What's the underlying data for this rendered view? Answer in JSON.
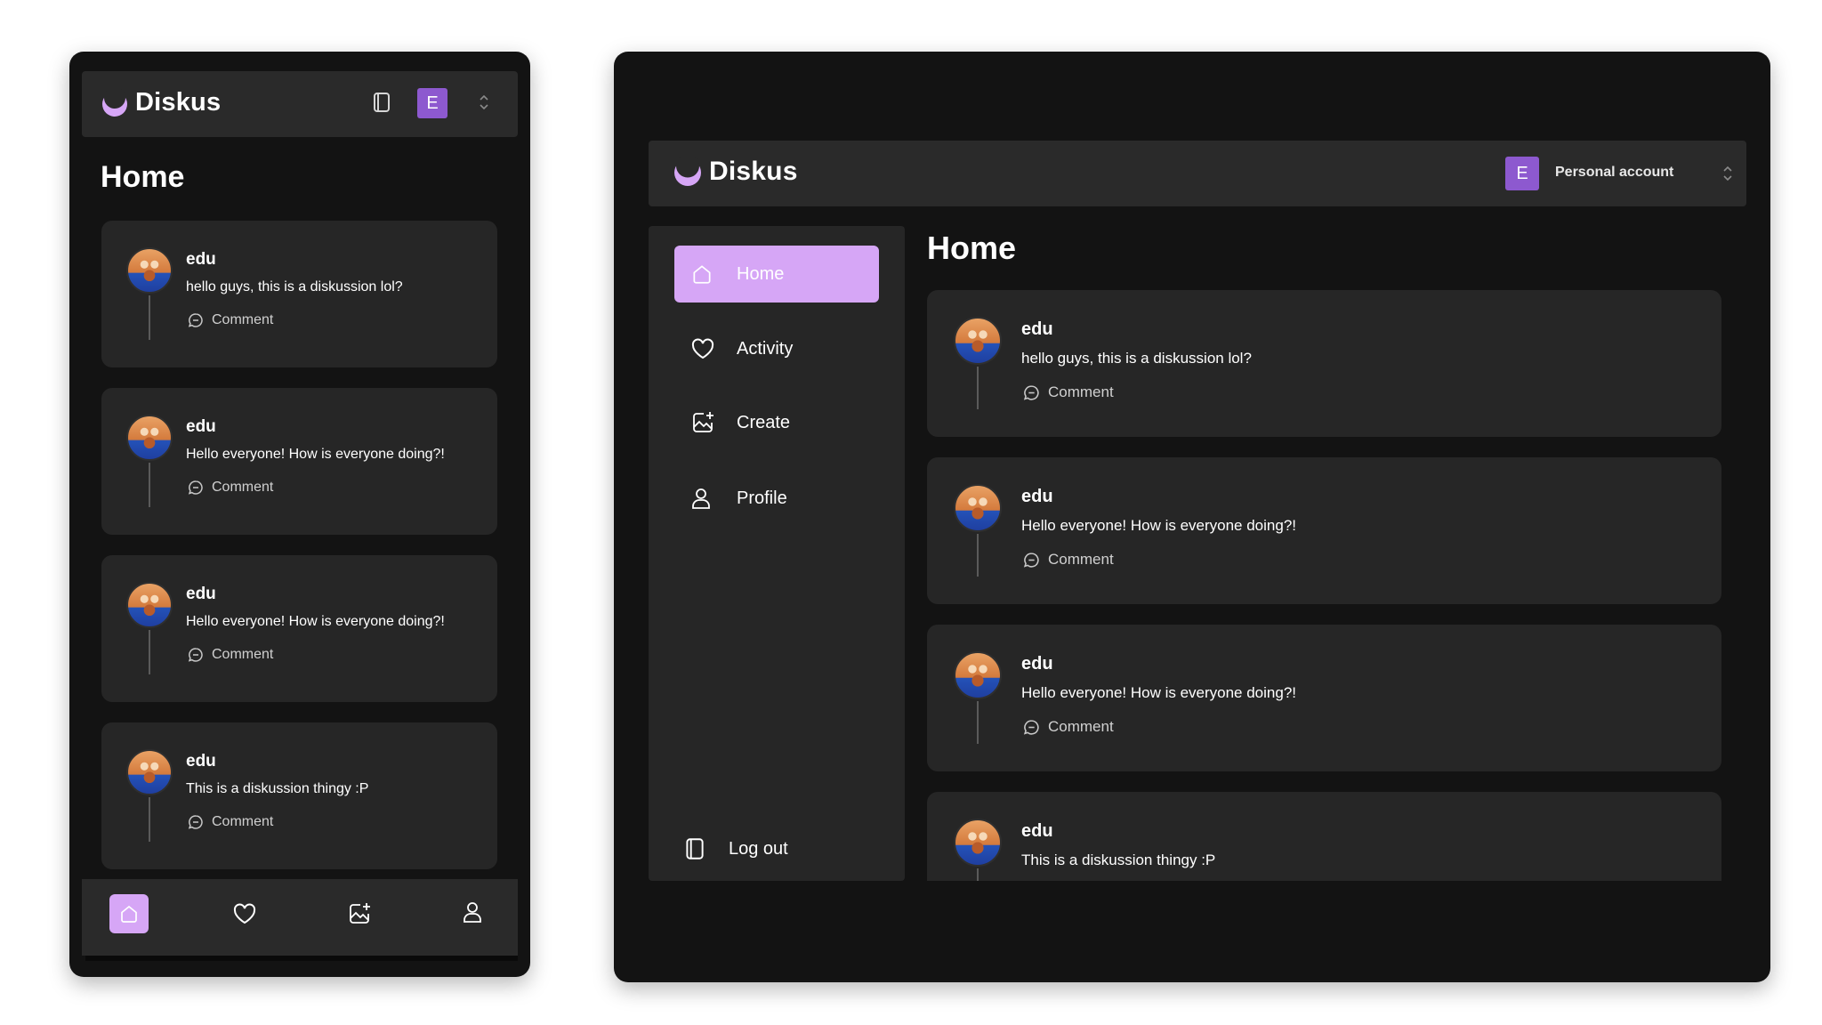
{
  "app": {
    "name": "Diskus",
    "accent_color": "#d6a6f6",
    "avatar_color": "#8d59cf",
    "background_color": "#131313",
    "card_color": "#262626"
  },
  "account": {
    "initial": "E",
    "label": "Personal account"
  },
  "page": {
    "title": "Home"
  },
  "sidebar": {
    "items": [
      {
        "label": "Home",
        "icon": "home-icon",
        "active": true
      },
      {
        "label": "Activity",
        "icon": "heart-icon",
        "active": false
      },
      {
        "label": "Create",
        "icon": "create-icon",
        "active": false
      },
      {
        "label": "Profile",
        "icon": "user-icon",
        "active": false
      }
    ],
    "logout_label": "Log out"
  },
  "bottom_nav": {
    "items": [
      {
        "icon": "home-icon",
        "active": true
      },
      {
        "icon": "heart-icon",
        "active": false
      },
      {
        "icon": "create-icon",
        "active": false
      },
      {
        "icon": "user-icon",
        "active": false
      }
    ]
  },
  "posts": [
    {
      "author": "edu",
      "text": "hello guys, this is a diskussion lol?",
      "comment_label": "Comment"
    },
    {
      "author": "edu",
      "text": "Hello everyone! How is everyone doing?!",
      "comment_label": "Comment"
    },
    {
      "author": "edu",
      "text": "Hello everyone! How is everyone doing?!",
      "comment_label": "Comment"
    },
    {
      "author": "edu",
      "text": "This is a diskussion thingy :P",
      "comment_label": "Comment"
    }
  ]
}
